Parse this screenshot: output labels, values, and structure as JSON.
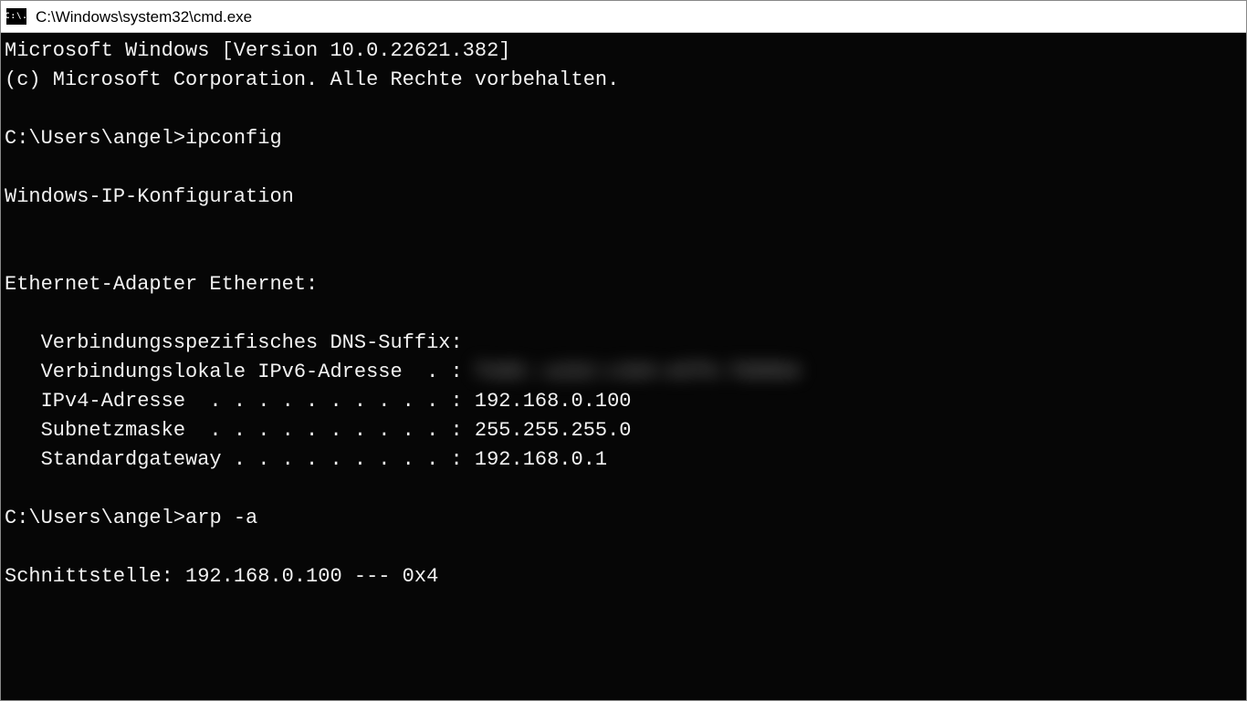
{
  "titlebar": {
    "icon_text": "C:\\.",
    "title": "C:\\Windows\\system32\\cmd.exe"
  },
  "term": {
    "l1": "Microsoft Windows [Version 10.0.22621.382]",
    "l2": "(c) Microsoft Corporation. Alle Rechte vorbehalten.",
    "blank": "",
    "prompt1": "C:\\Users\\angel>",
    "cmd1": "ipconfig",
    "l5": "Windows-IP-Konfiguration",
    "l6": "Ethernet-Adapter Ethernet:",
    "dns_label": "   Verbindungsspezifisches DNS-Suffix:",
    "ipv6_label": "   Verbindungslokale IPv6-Adresse  . : ",
    "ipv6_value_blurred": "fe80::a1b2:c3d4:e5f6:7890%4",
    "ipv4_line": "   IPv4-Adresse  . . . . . . . . . . : 192.168.0.100",
    "subnet_line": "   Subnetzmaske  . . . . . . . . . . : 255.255.255.0",
    "gw_line": "   Standardgateway . . . . . . . . . : 192.168.0.1",
    "prompt2": "C:\\Users\\angel>",
    "cmd2": "arp -a",
    "iface_line": "Schnittstelle: 192.168.0.100 --- 0x4"
  }
}
